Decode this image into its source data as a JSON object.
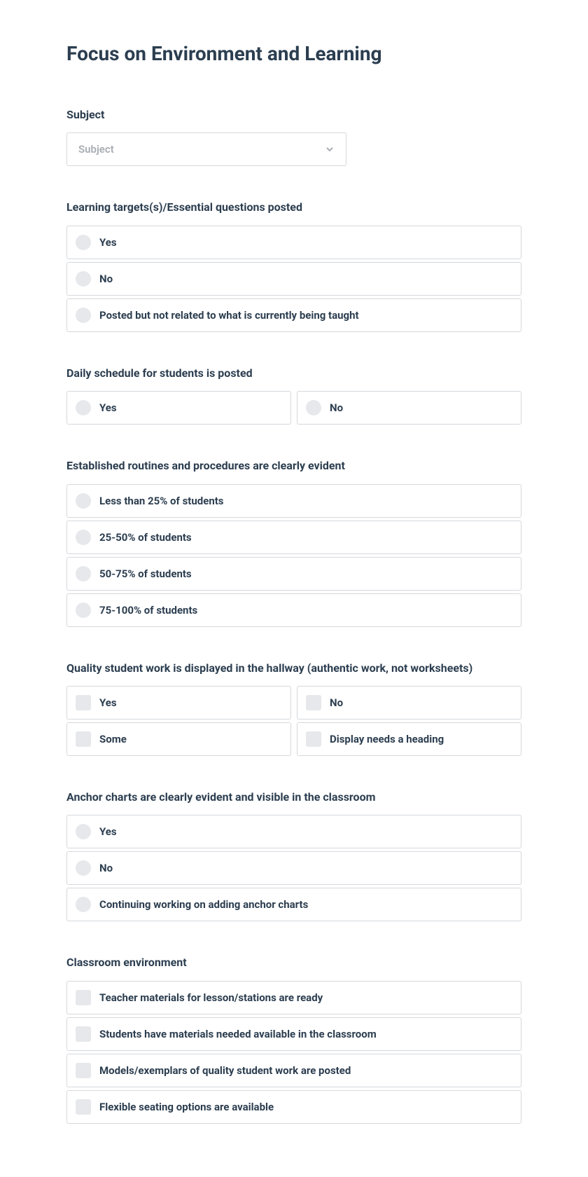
{
  "title": "Focus on Environment and Learning",
  "subject": {
    "label": "Subject",
    "placeholder": "Subject"
  },
  "learning_targets": {
    "label": "Learning targets(s)/Essential questions posted",
    "options": [
      "Yes",
      "No",
      "Posted but not related to what is currently being taught"
    ]
  },
  "daily_schedule": {
    "label": "Daily schedule for students is posted",
    "options": [
      "Yes",
      "No"
    ]
  },
  "routines": {
    "label": "Established routines and procedures are clearly evident",
    "options": [
      "Less than 25% of students",
      "25-50% of students",
      "50-75% of students",
      "75-100% of students"
    ]
  },
  "student_work": {
    "label": "Quality student work is displayed in the hallway (authentic work, not worksheets)",
    "options": [
      "Yes",
      "No",
      "Some",
      "Display needs a heading"
    ]
  },
  "anchor_charts": {
    "label": "Anchor charts are clearly evident and visible in the classroom",
    "options": [
      "Yes",
      "No",
      "Continuing working on adding anchor charts"
    ]
  },
  "classroom_env": {
    "label": "Classroom environment",
    "options": [
      "Teacher materials for lesson/stations are ready",
      "Students have materials needed available in the classroom",
      "Models/exemplars of quality student work are posted",
      "Flexible seating options are available"
    ]
  }
}
